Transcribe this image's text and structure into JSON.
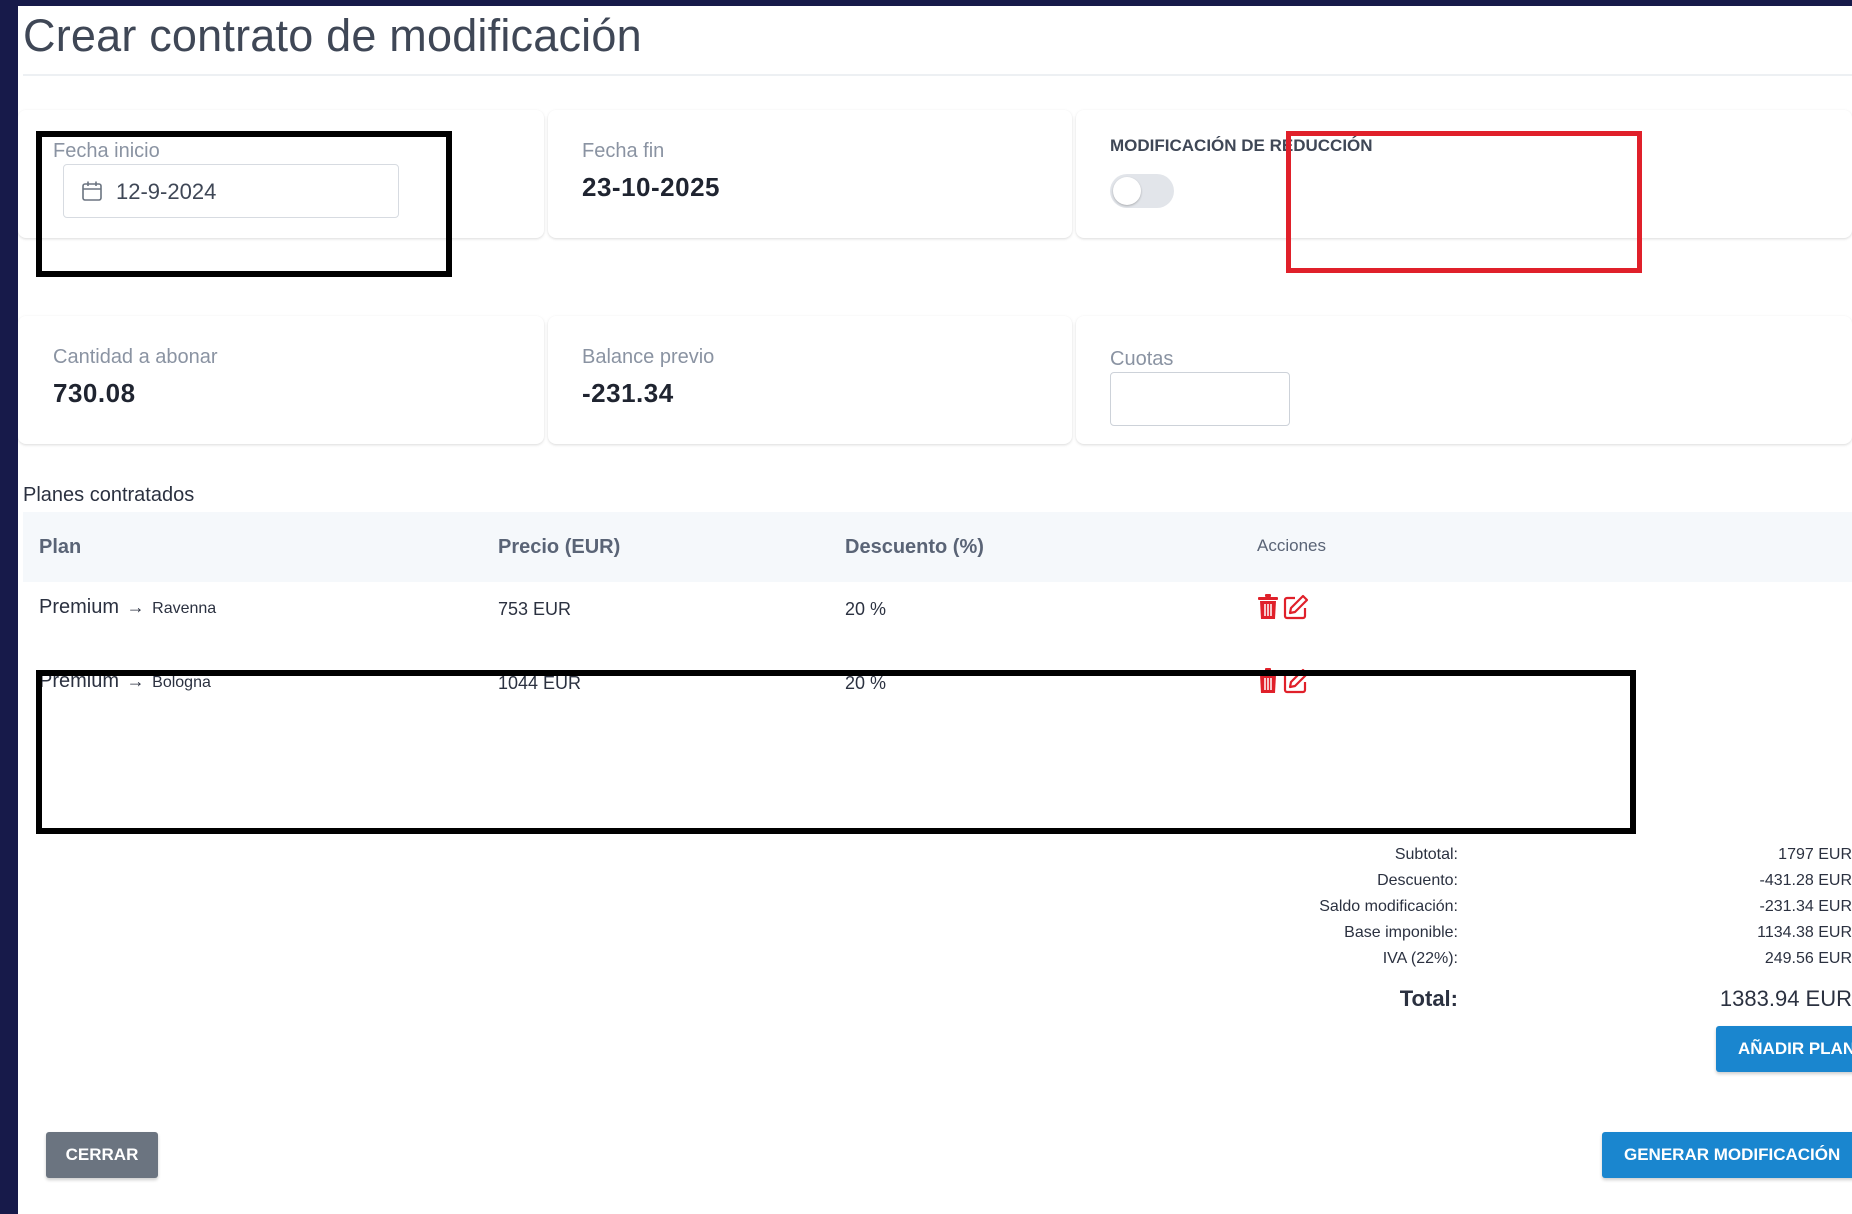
{
  "page": {
    "title": "Crear contrato de modificación"
  },
  "cards": {
    "fecha_inicio": {
      "label": "Fecha inicio",
      "value": "12-9-2024"
    },
    "fecha_fin": {
      "label": "Fecha fin",
      "value": "23-10-2025"
    },
    "modificacion_reduccion": {
      "label": "MODIFICACIÓN DE REDUCCIÓN",
      "enabled": false
    },
    "cantidad_abonar": {
      "label": "Cantidad a abonar",
      "value": "730.08"
    },
    "balance_previo": {
      "label": "Balance previo",
      "value": "-231.34"
    },
    "cuotas": {
      "label": "Cuotas",
      "value": ""
    }
  },
  "plans": {
    "section_label": "Planes contratados",
    "columns": [
      "Plan",
      "Precio (EUR)",
      "Descuento (%)",
      "Acciones"
    ],
    "rows": [
      {
        "plan": "Premium",
        "arrow": "→",
        "city": "Ravenna",
        "price": "753 EUR",
        "discount": "20 %"
      },
      {
        "plan": "Premium",
        "arrow": "→",
        "city": "Bologna",
        "price": "1044 EUR",
        "discount": "20 %"
      }
    ],
    "icons": {
      "delete": "trash-icon",
      "edit": "edit-icon",
      "calendar": "calendar-icon"
    }
  },
  "summary": {
    "subtotal_label": "Subtotal:",
    "subtotal_value": "1797 EUR",
    "descuento_label": "Descuento:",
    "descuento_value": "-431.28 EUR",
    "saldo_label": "Saldo modificación:",
    "saldo_value": "-231.34 EUR",
    "base_label": "Base imponible:",
    "base_value": "1134.38 EUR",
    "iva_label": "IVA (22%):",
    "iva_value": "249.56 EUR",
    "total_label": "Total:",
    "total_value": "1383.94 EUR"
  },
  "buttons": {
    "add_plan": "AÑADIR PLAN",
    "close": "CERRAR",
    "generate": "GENERAR MODIFICACIÓN"
  },
  "colors": {
    "frame": "#171a4a",
    "primary_button": "#1a86cf",
    "secondary_button": "#6b7480",
    "action_icons": "#e0202a",
    "highlight_black": "#000000",
    "highlight_red": "#e0202a"
  }
}
